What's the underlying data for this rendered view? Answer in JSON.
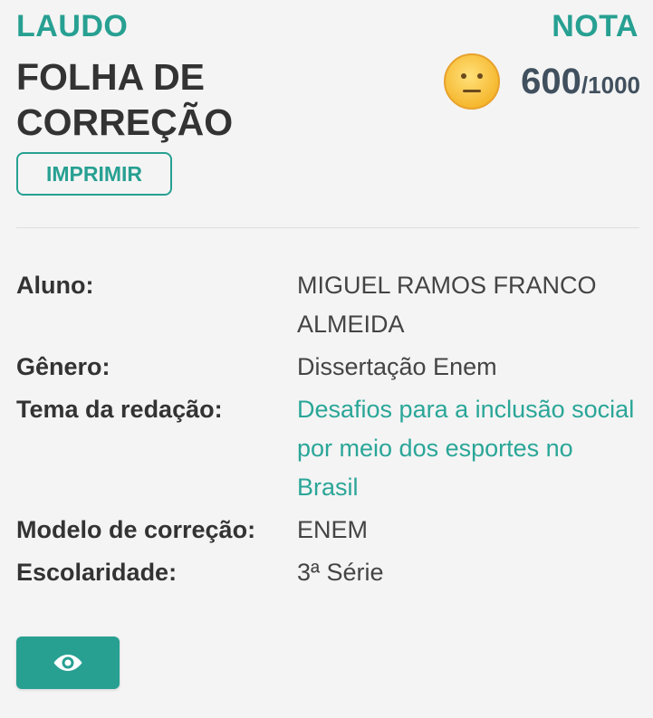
{
  "header": {
    "laudo_label": "LAUDO",
    "title": "FOLHA DE CORREÇÃO",
    "print_label": "IMPRIMIR",
    "nota_label": "NOTA",
    "score": "600",
    "score_max": "/1000",
    "face_icon": "neutral-face-icon"
  },
  "info": {
    "aluno_label": "Aluno:",
    "aluno_value": "MIGUEL RAMOS FRANCO ALMEIDA",
    "genero_label": "Gênero:",
    "genero_value": "Dissertação Enem",
    "tema_label": "Tema da redação:",
    "tema_value": "Desafios para a inclusão social por meio dos esportes no Brasil",
    "modelo_label": "Modelo de correção:",
    "modelo_value": "ENEM",
    "escolaridade_label": "Escolaridade:",
    "escolaridade_value": "3ª Série"
  },
  "actions": {
    "view_icon": "eye-icon"
  },
  "colors": {
    "accent": "#27a092",
    "title": "#333333",
    "score": "#41505e",
    "background": "#f4f4f4",
    "face": "#f9c63a"
  }
}
